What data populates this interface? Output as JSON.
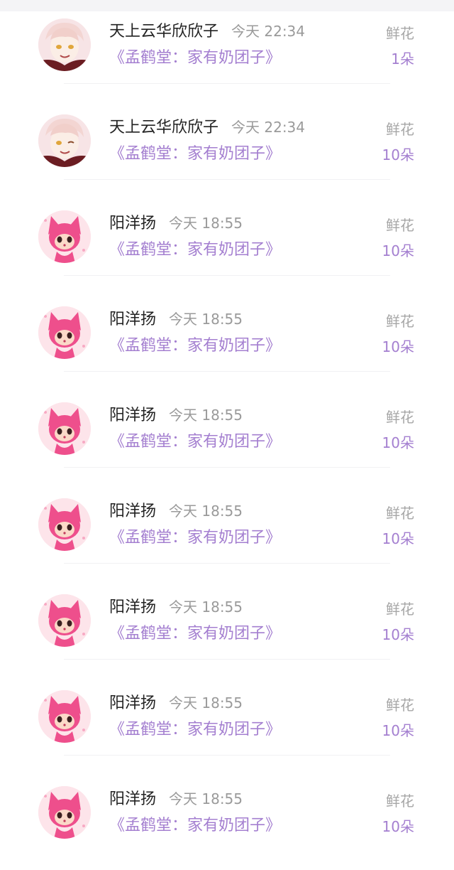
{
  "rows": [
    {
      "user": "天上云华欣欣子",
      "time": "今天 22:34",
      "book": "《孟鹤堂：家有奶团子》",
      "gift_type": "鲜花",
      "gift_count": "1朵",
      "avatar": "anime-boy-avatar"
    },
    {
      "user": "天上云华欣欣子",
      "time": "今天 22:34",
      "book": "《孟鹤堂：家有奶团子》",
      "gift_type": "鲜花",
      "gift_count": "10朵",
      "avatar": "anime-boy-avatar"
    },
    {
      "user": "阳洋扬",
      "time": "今天 18:55",
      "book": "《孟鹤堂：家有奶团子》",
      "gift_type": "鲜花",
      "gift_count": "10朵",
      "avatar": "pink-fox-avatar"
    },
    {
      "user": "阳洋扬",
      "time": "今天 18:55",
      "book": "《孟鹤堂：家有奶团子》",
      "gift_type": "鲜花",
      "gift_count": "10朵",
      "avatar": "pink-fox-avatar"
    },
    {
      "user": "阳洋扬",
      "time": "今天 18:55",
      "book": "《孟鹤堂：家有奶团子》",
      "gift_type": "鲜花",
      "gift_count": "10朵",
      "avatar": "pink-fox-avatar"
    },
    {
      "user": "阳洋扬",
      "time": "今天 18:55",
      "book": "《孟鹤堂：家有奶团子》",
      "gift_type": "鲜花",
      "gift_count": "10朵",
      "avatar": "pink-fox-avatar"
    },
    {
      "user": "阳洋扬",
      "time": "今天 18:55",
      "book": "《孟鹤堂：家有奶团子》",
      "gift_type": "鲜花",
      "gift_count": "10朵",
      "avatar": "pink-fox-avatar"
    },
    {
      "user": "阳洋扬",
      "time": "今天 18:55",
      "book": "《孟鹤堂：家有奶团子》",
      "gift_type": "鲜花",
      "gift_count": "10朵",
      "avatar": "pink-fox-avatar"
    },
    {
      "user": "阳洋扬",
      "time": "今天 18:55",
      "book": "《孟鹤堂：家有奶团子》",
      "gift_type": "鲜花",
      "gift_count": "10朵",
      "avatar": "pink-fox-avatar"
    }
  ],
  "colors": {
    "accent": "#a47fd0",
    "name": "#222222",
    "muted": "#9a9a9a"
  }
}
